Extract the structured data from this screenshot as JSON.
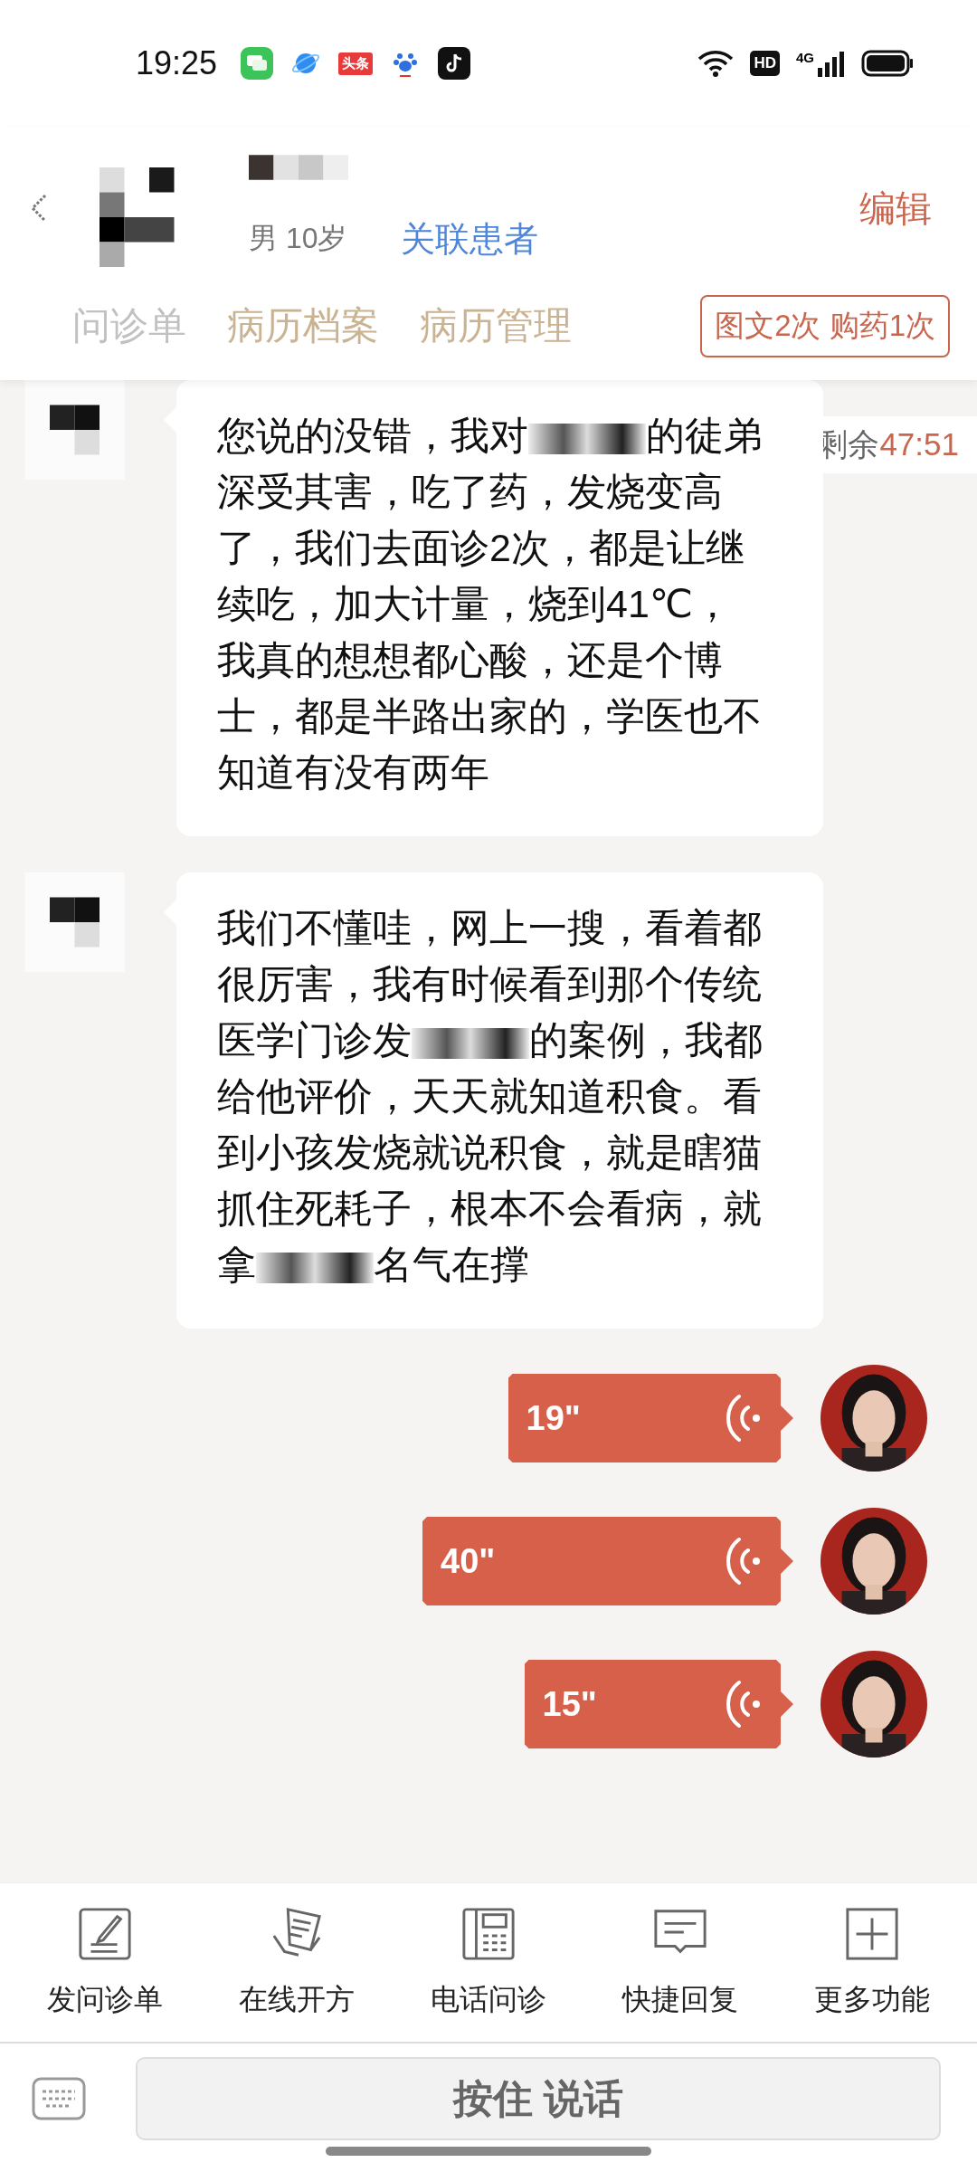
{
  "status_bar": {
    "time": "19:25",
    "news_badge": "头条",
    "hd": "HD",
    "network": "4G"
  },
  "header": {
    "patient_info": "男 10岁",
    "link_patient": "关联患者",
    "edit": "编辑"
  },
  "tabs": [
    {
      "label": "问诊单",
      "faded": true
    },
    {
      "label": "病历档案",
      "faded": false
    },
    {
      "label": "病历管理",
      "faded": false
    }
  ],
  "quota_badge": "图文2次 购药1次",
  "timer": {
    "label": "剩余",
    "time": "47:51"
  },
  "messages": [
    {
      "kind": "text",
      "parts": [
        {
          "kind": "text",
          "text": "您说的没错，我对"
        },
        {
          "kind": "redacted"
        },
        {
          "kind": "text",
          "text": "的徒弟深受其害，吃了药，发烧变高了，我们去面诊2次，都是让继续吃，加大计量，烧到41℃，我真的想想都心酸，还是个博士，都是半路出家的，学医也不知道有没有两年"
        }
      ]
    },
    {
      "kind": "text",
      "parts": [
        {
          "kind": "text",
          "text": "我们不懂哇，网上一搜，看着都很厉害，我有时候看到那个传统医学门诊发"
        },
        {
          "kind": "redacted"
        },
        {
          "kind": "text",
          "text": "的案例，我都给他评价，天天就知道积食。看到小孩发烧就说积食，就是瞎猫抓住死耗子，根本不会看病，就拿"
        },
        {
          "kind": "redacted"
        },
        {
          "kind": "text",
          "text": "名气在撑"
        }
      ]
    },
    {
      "kind": "voice",
      "duration": "19\""
    },
    {
      "kind": "voice",
      "duration": "40\""
    },
    {
      "kind": "voice",
      "duration": "15\""
    }
  ],
  "toolbar": [
    {
      "kind": "form",
      "label": "发问诊单"
    },
    {
      "kind": "prescription",
      "label": "在线开方"
    },
    {
      "kind": "phone",
      "label": "电话问诊"
    },
    {
      "kind": "reply",
      "label": "快捷回复"
    },
    {
      "kind": "more",
      "label": "更多功能"
    }
  ],
  "input": {
    "hold_to_talk": "按住 说话"
  }
}
